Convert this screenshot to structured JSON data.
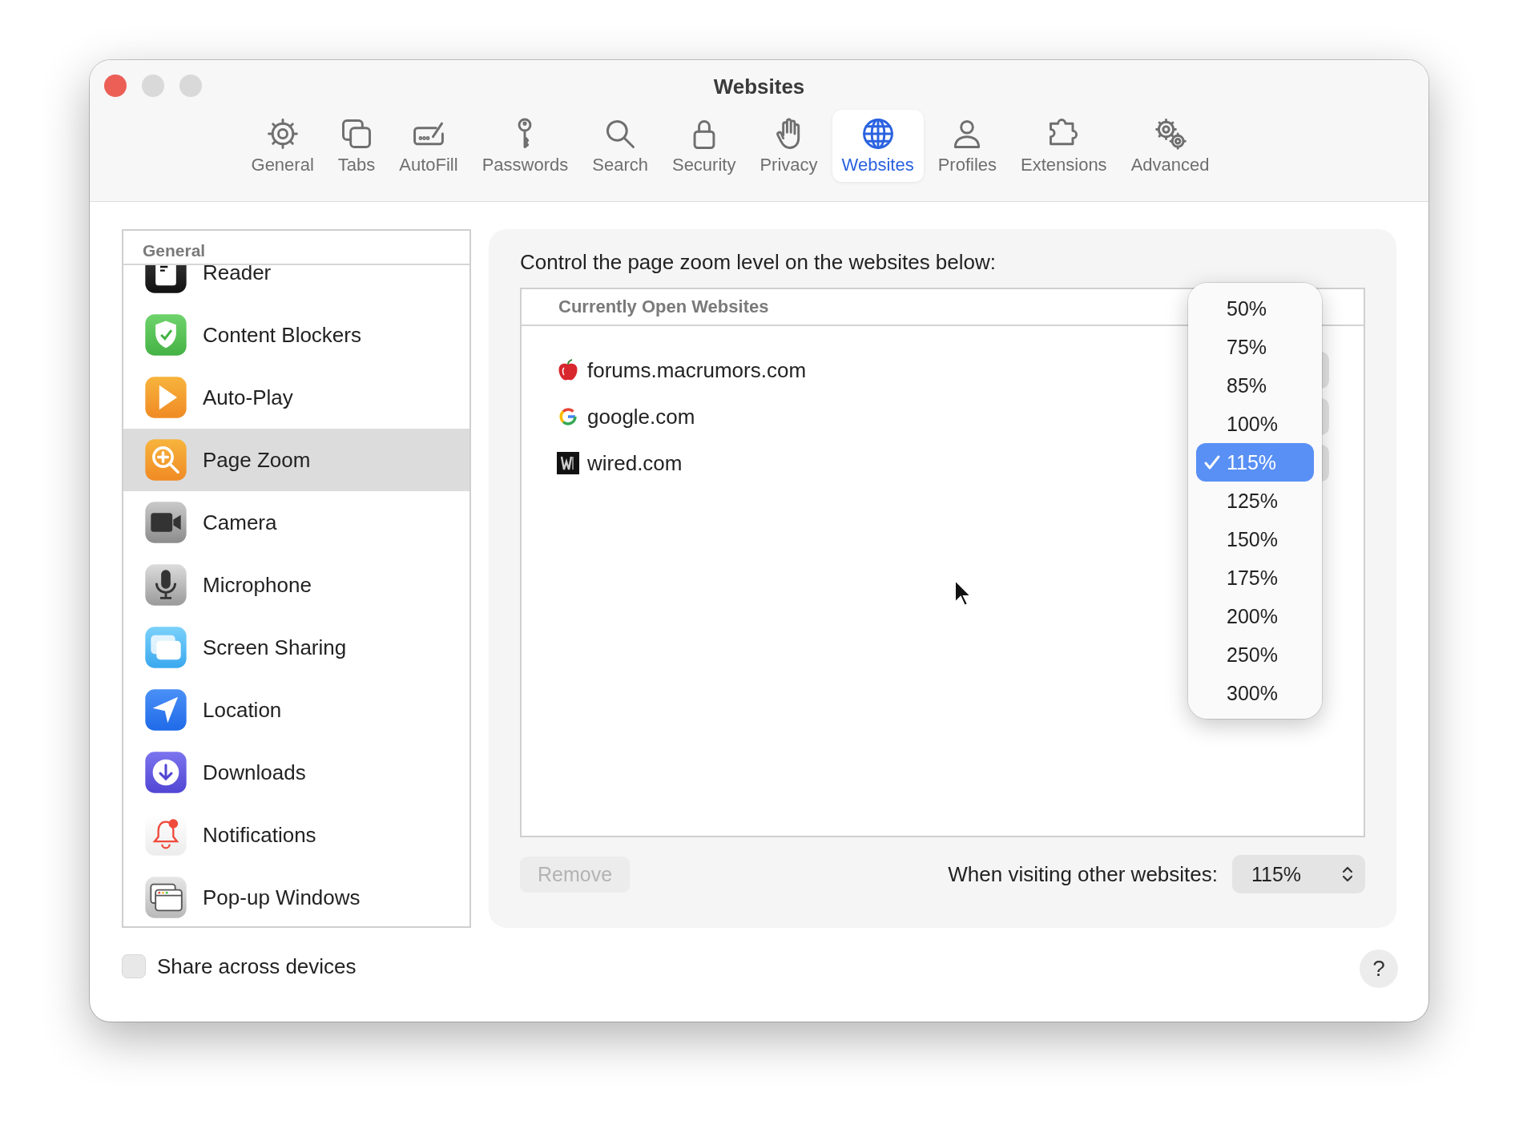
{
  "window": {
    "title": "Websites"
  },
  "toolbar": [
    {
      "label": "General",
      "selected": false
    },
    {
      "label": "Tabs",
      "selected": false
    },
    {
      "label": "AutoFill",
      "selected": false
    },
    {
      "label": "Passwords",
      "selected": false
    },
    {
      "label": "Search",
      "selected": false
    },
    {
      "label": "Security",
      "selected": false
    },
    {
      "label": "Privacy",
      "selected": false
    },
    {
      "label": "Websites",
      "selected": true
    },
    {
      "label": "Profiles",
      "selected": false
    },
    {
      "label": "Extensions",
      "selected": false
    },
    {
      "label": "Advanced",
      "selected": false
    }
  ],
  "sidebar": {
    "header": "General",
    "items": [
      {
        "label": "Reader",
        "selected": false
      },
      {
        "label": "Content Blockers",
        "selected": false
      },
      {
        "label": "Auto-Play",
        "selected": false
      },
      {
        "label": "Page Zoom",
        "selected": true
      },
      {
        "label": "Camera",
        "selected": false
      },
      {
        "label": "Microphone",
        "selected": false
      },
      {
        "label": "Screen Sharing",
        "selected": false
      },
      {
        "label": "Location",
        "selected": false
      },
      {
        "label": "Downloads",
        "selected": false
      },
      {
        "label": "Notifications",
        "selected": false
      },
      {
        "label": "Pop-up Windows",
        "selected": false
      }
    ]
  },
  "panel": {
    "description": "Control the page zoom level on the websites below:",
    "table": {
      "header": "Currently Open Websites",
      "rows": [
        {
          "site": "forums.macrumors.com"
        },
        {
          "site": "google.com"
        },
        {
          "site": "wired.com"
        }
      ]
    },
    "remove_button": {
      "label": "Remove",
      "disabled": true
    },
    "default_label": "When visiting other websites:",
    "default_popup": "115%"
  },
  "zoom_menu": [
    {
      "label": "50%",
      "selected": false
    },
    {
      "label": "75%",
      "selected": false
    },
    {
      "label": "85%",
      "selected": false
    },
    {
      "label": "100%",
      "selected": false
    },
    {
      "label": "115%",
      "selected": true
    },
    {
      "label": "125%",
      "selected": false
    },
    {
      "label": "150%",
      "selected": false
    },
    {
      "label": "175%",
      "selected": false
    },
    {
      "label": "200%",
      "selected": false
    },
    {
      "label": "250%",
      "selected": false
    },
    {
      "label": "300%",
      "selected": false
    }
  ],
  "share_checkbox": {
    "label": "Share across devices",
    "checked": false
  },
  "help_button": "?"
}
